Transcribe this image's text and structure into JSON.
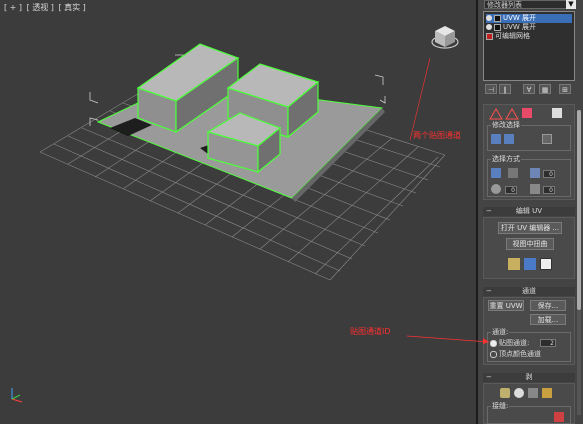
{
  "viewport": {
    "label_parts": [
      "[ + ]",
      "[ 透视 ]",
      "[ 真实 ]"
    ]
  },
  "modifier_panel": {
    "modifier_list_label": "修改器列表",
    "stack_items": [
      {
        "label": "UVW 展开",
        "selected": true
      },
      {
        "label": "UVW 展开",
        "selected": false
      },
      {
        "label": "可编辑网格",
        "selected": false
      }
    ]
  },
  "rollouts": {
    "selection": {
      "title": "修改选择",
      "mode_title": "选择方式",
      "spinner_values": [
        "0",
        "0",
        "0"
      ]
    },
    "edit_uv": {
      "header": "编辑 UV",
      "open_editor": "打开 UV 编辑器 ...",
      "tweak_in_view": "视图中扭曲"
    },
    "channel": {
      "header": "通道",
      "reset_uvw": "重置 UVW",
      "save": "保存...",
      "load": "加载...",
      "group_title": "通道:",
      "map_channel_label": "贴图通道:",
      "map_channel_value": "2",
      "vertex_color_label": "顶点颜色通道"
    },
    "peel": {
      "header": "剥",
      "seams_title": "接缝:"
    }
  },
  "annotations": {
    "two_channels": "两个贴图通道",
    "channel_id": "贴图通道ID"
  },
  "colors": {
    "selection_green": "#4dff3a",
    "annotation_red": "#ff3030",
    "selected_item": "#3a6fb8"
  }
}
